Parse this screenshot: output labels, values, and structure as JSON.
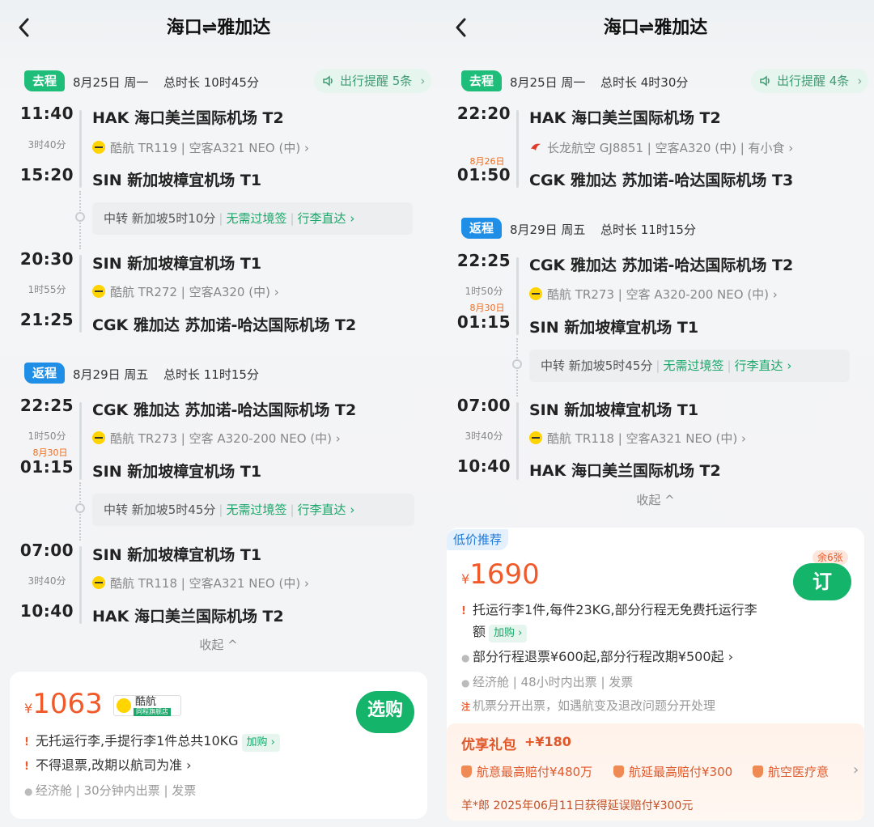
{
  "left": {
    "title": "海口⇌雅加达",
    "outbound": {
      "tag": "去程",
      "date": "8月25日 周一",
      "total": "总时长 10时45分",
      "reminder": "出行提醒 5条",
      "seg1": {
        "dep_time": "11:40",
        "dur": "3时40分",
        "arr_time": "15:20",
        "dep_airport": "HAK 海口美兰国际机场 T2",
        "flight": "酷航 TR119 | 空客A321 NEO (中) ›",
        "arr_airport": "SIN 新加坡樟宜机场 T1"
      },
      "transfer": {
        "text": "中转 新加坡5时10分",
        "visa": "无需过境签",
        "bag": "行李直达 ›"
      },
      "seg2": {
        "dep_time": "20:30",
        "dur": "1时55分",
        "arr_time": "21:25",
        "dep_airport": "SIN 新加坡樟宜机场 T1",
        "flight": "酷航 TR272 | 空客A320 (中) ›",
        "arr_airport": "CGK 雅加达 苏加诺-哈达国际机场 T2"
      }
    },
    "return": {
      "tag": "返程",
      "date": "8月29日 周五",
      "total": "总时长 11时15分",
      "seg1": {
        "dep_time": "22:25",
        "dur": "1时50分",
        "next_day": "8月30日",
        "arr_time": "01:15",
        "dep_airport": "CGK 雅加达 苏加诺-哈达国际机场 T2",
        "flight": "酷航 TR273 | 空客 A320-200 NEO (中) ›",
        "arr_airport": "SIN 新加坡樟宜机场 T1"
      },
      "transfer": {
        "text": "中转 新加坡5时45分",
        "visa": "无需过境签",
        "bag": "行李直达 ›"
      },
      "seg2": {
        "dep_time": "07:00",
        "dur": "3时40分",
        "arr_time": "10:40",
        "dep_airport": "SIN 新加坡樟宜机场 T1",
        "flight": "酷航 TR118 | 空客A321 NEO (中) ›",
        "arr_airport": "HAK 海口美兰国际机场 T2"
      }
    },
    "collapse": "收起 ^",
    "card": {
      "yen": "¥",
      "price": "1063",
      "brand_name": "酷航",
      "brand_sub": "同程旗舰店",
      "buy": "选购",
      "rule1": "无托运行李,手提行李1件总共10KG",
      "rule1_pill": "加购 ›",
      "rule2": "不得退票,改期以航司为准 ›",
      "meta": "经济舱 | 30分钟内出票 | 发票"
    }
  },
  "right": {
    "title": "海口⇌雅加达",
    "outbound": {
      "tag": "去程",
      "date": "8月25日 周一",
      "total": "总时长 4时30分",
      "reminder": "出行提醒 4条",
      "seg1": {
        "dep_time": "22:20",
        "next_day": "8月26日",
        "arr_time": "01:50",
        "dep_airport": "HAK 海口美兰国际机场 T2",
        "flight": "长龙航空 GJ8851 | 空客A320 (中) | 有小食 ›",
        "arr_airport": "CGK 雅加达 苏加诺-哈达国际机场 T3"
      }
    },
    "return": {
      "tag": "返程",
      "date": "8月29日 周五",
      "total": "总时长 11时15分",
      "seg1": {
        "dep_time": "22:25",
        "dur": "1时50分",
        "next_day": "8月30日",
        "arr_time": "01:15",
        "dep_airport": "CGK 雅加达 苏加诺-哈达国际机场 T2",
        "flight": "酷航 TR273 | 空客 A320-200 NEO (中) ›",
        "arr_airport": "SIN 新加坡樟宜机场 T1"
      },
      "transfer": {
        "text": "中转 新加坡5时45分",
        "visa": "无需过境签",
        "bag": "行李直达 ›"
      },
      "seg2": {
        "dep_time": "07:00",
        "dur": "3时40分",
        "arr_time": "10:40",
        "dep_airport": "SIN 新加坡樟宜机场 T1",
        "flight": "酷航 TR118 | 空客A321 NEO (中) ›",
        "arr_airport": "HAK 海口美兰国际机场 T2"
      }
    },
    "collapse": "收起 ^",
    "card": {
      "low_tag": "低价推荐",
      "yen": "¥",
      "price": "1690",
      "remain": "余6张",
      "buy": "订",
      "rule1a": "托运行李1件,每件23KG,部分行程无免费托运行李",
      "rule1b": "额",
      "rule1_pill": "加购 ›",
      "rule2": "部分行程退票¥600起,部分行程改期¥500起 ›",
      "meta": "经济舱 | 48小时内出票 | 发票",
      "note": "机票分开出票，如遇航变及退改问题分开处理",
      "note_mark": "注",
      "gift_title": "优享礼包",
      "gift_amount": "+¥180",
      "gift_items": [
        "航意最高赔付¥480万",
        "航延最高赔付¥300",
        "航空医疗意"
      ],
      "gift_more": "›",
      "gift_note": "羊*郎 2025年06月11日获得延误赔付¥300元"
    }
  }
}
